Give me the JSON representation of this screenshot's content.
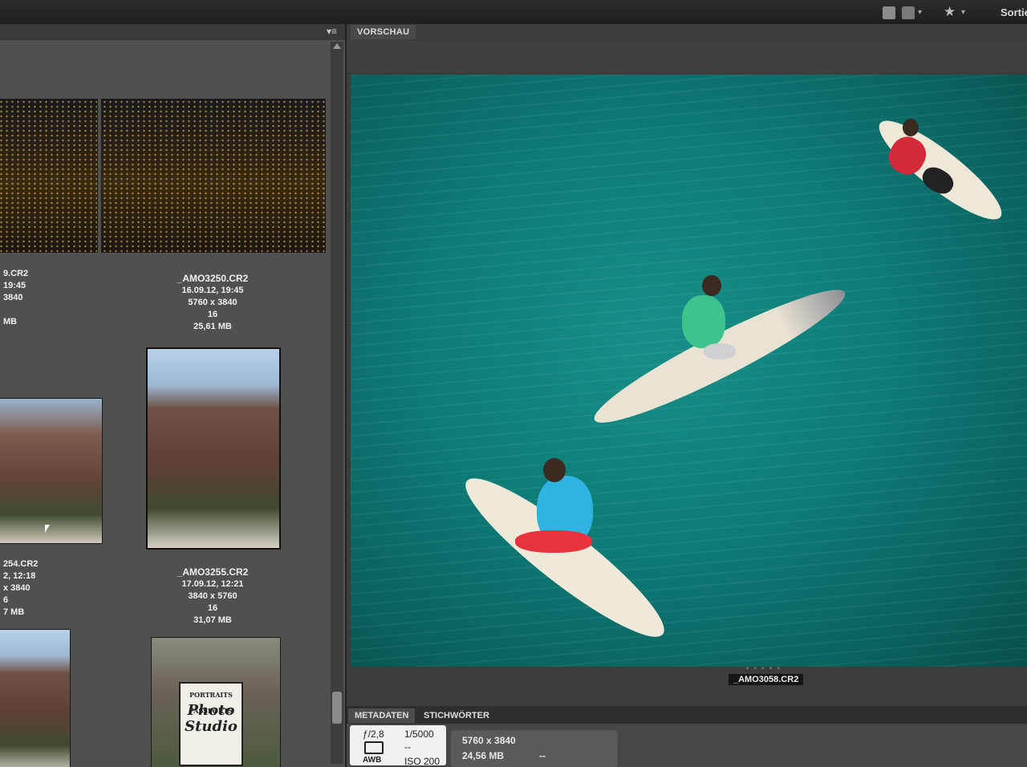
{
  "toolbar": {
    "icons": [
      "grid-view-icon",
      "single-view-icon",
      "star-icon"
    ],
    "sort_label": "Sortie"
  },
  "browser": {
    "rows": [
      {
        "filename": "9.CR2",
        "date": "19:45",
        "size": "3840",
        "bits": "",
        "filesize": "MB"
      },
      {
        "filename": "_AMO3250.CR2",
        "date": "16.09.12, 19:45",
        "size": "5760 x 3840",
        "bits": "16",
        "filesize": "25,61 MB"
      },
      {
        "filename": "254.CR2",
        "date": "2, 12:18",
        "size": "x 3840",
        "bits": "6",
        "filesize": "7 MB"
      },
      {
        "filename": "_AMO3255.CR2",
        "date": "17.09.12, 12:21",
        "size": "3840 x 5760",
        "bits": "16",
        "filesize": "31,07 MB"
      }
    ],
    "sign_top": "PORTRAITS PASSPORTS",
    "sign_text": "Photo Studio"
  },
  "preview": {
    "tab_label": "VORSCHAU",
    "filename": "_AMO3058.CR2",
    "dots": "• • • • •"
  },
  "panel_tabs": {
    "metadata": "METADATEN",
    "keywords": "STICHWÖRTER"
  },
  "metadata": {
    "aperture": "ƒ/2,8",
    "shutter": "1/5000",
    "dash1": "--",
    "wb": "AWB",
    "iso": "ISO 200",
    "dimensions": "5760 x 3840",
    "filesize": "24,56 MB",
    "dash2": "--"
  }
}
